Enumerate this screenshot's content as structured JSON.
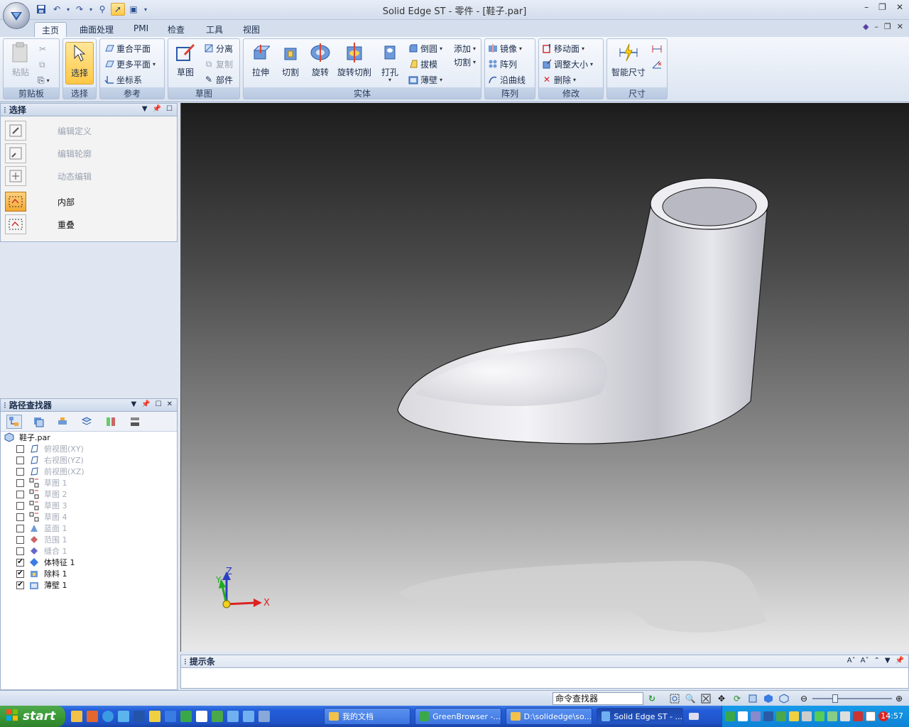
{
  "window": {
    "title": "Solid Edge ST - 零件 - [鞋子.par]"
  },
  "tabs": [
    "主页",
    "曲面处理",
    "PMI",
    "检查",
    "工具",
    "视图"
  ],
  "ribbon": {
    "clipboard": {
      "label": "剪贴板",
      "paste": "粘贴"
    },
    "select": {
      "label": "选择",
      "select": "选择"
    },
    "reference": {
      "label": "参考",
      "coincident_plane": "重合平面",
      "more_planes": "更多平面",
      "coord_system": "坐标系"
    },
    "sketch": {
      "label": "草图",
      "sketch": "草图",
      "split": "分离",
      "copy": "复制",
      "part": "部件"
    },
    "solid": {
      "label": "实体",
      "extrude": "拉伸",
      "cut": "切割",
      "revolve": "旋转",
      "revolve_cut": "旋转切削",
      "hole": "打孔",
      "round": "倒圆",
      "add": "添加",
      "draft": "拔模",
      "cut2": "切割",
      "thin_wall": "薄壁"
    },
    "pattern": {
      "label": "阵列",
      "mirror": "镜像",
      "pattern": "阵列",
      "along_curve": "沿曲线"
    },
    "modify": {
      "label": "修改",
      "move_face": "移动面",
      "resize": "调整大小",
      "delete": "删除"
    },
    "dimension": {
      "label": "尺寸",
      "smart_dim": "智能尺寸"
    }
  },
  "select_panel": {
    "title": "选择",
    "items": [
      {
        "label": "编辑定义",
        "enabled": false
      },
      {
        "label": "编辑轮廓",
        "enabled": false
      },
      {
        "label": "动态编辑",
        "enabled": false
      },
      {
        "label": "内部",
        "enabled": true
      },
      {
        "label": "重叠",
        "enabled": true
      }
    ]
  },
  "pathfinder": {
    "title": "路径查找器",
    "root": "鞋子.par",
    "items": [
      {
        "label": "俯视图(XY)",
        "checked": false,
        "dim": true
      },
      {
        "label": "右视图(YZ)",
        "checked": false,
        "dim": true
      },
      {
        "label": "前视图(XZ)",
        "checked": false,
        "dim": true
      },
      {
        "label": "草图 1",
        "checked": false,
        "dim": true
      },
      {
        "label": "草图 2",
        "checked": false,
        "dim": true
      },
      {
        "label": "草图 3",
        "checked": false,
        "dim": true
      },
      {
        "label": "草图 4",
        "checked": false,
        "dim": true
      },
      {
        "label": "蓝面 1",
        "checked": false,
        "dim": true
      },
      {
        "label": "范围 1",
        "checked": false,
        "dim": true
      },
      {
        "label": "缝合 1",
        "checked": false,
        "dim": true
      },
      {
        "label": "体特征 1",
        "checked": true,
        "dim": false
      },
      {
        "label": "除料 1",
        "checked": true,
        "dim": false
      },
      {
        "label": "薄壁 1",
        "checked": true,
        "dim": false
      }
    ]
  },
  "viewport": {
    "axis_labels": {
      "x": "X",
      "y": "Y",
      "z": "Z"
    }
  },
  "prompt_bar": {
    "title": "提示条"
  },
  "status_bar": {
    "command_finder": "命令查找器"
  },
  "taskbar": {
    "start": "start",
    "tasks": [
      "我的文档",
      "GreenBrowser -...",
      "D:\\solidedge\\so...",
      "Solid Edge ST - ..."
    ],
    "clock": "14:57"
  },
  "colors": {
    "accent": "#ffc845",
    "ribbon_bg": "#dbe4f1",
    "taskbar": "#245edb"
  }
}
